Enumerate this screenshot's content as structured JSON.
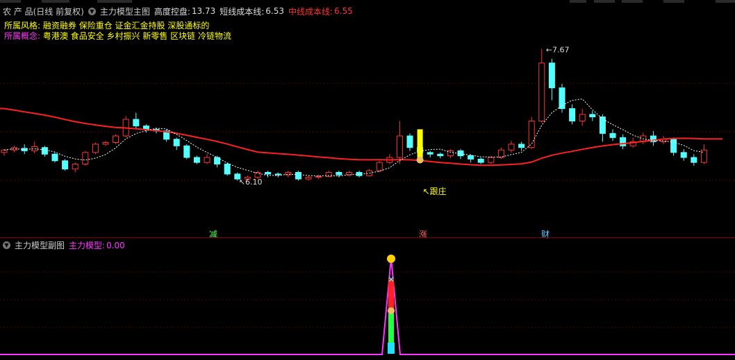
{
  "header": {
    "stock_title": "农 产 品(日线 前复权)",
    "indicator_name": "主力模型主图",
    "height_label": "高度控盘:",
    "height_value": "13.73",
    "short_label": "短线成本线:",
    "short_value": "6.53",
    "mid_label": "中线成本线:",
    "mid_value": "6.55"
  },
  "info": {
    "style_label": "所属风格:",
    "style_value": "融资融券 保险重仓 证金汇金持股 深股通标的",
    "concept_label": "所属概念:",
    "concept_value": "粤港澳 食品安全 乡村振兴 新零售 区块链 冷链物流"
  },
  "annotations": {
    "high_label": "7.67",
    "low_label": "6.10",
    "follow_label": "跟庄"
  },
  "markers": {
    "jian": "减",
    "zhang": "涨",
    "cai": "财"
  },
  "sub": {
    "title": "主力模型副图",
    "model_label": "主力模型:",
    "model_value": "0.00"
  },
  "colors": {
    "up": "#ff3333",
    "down": "#54ffff",
    "ma_line": "#ff2020",
    "short_line": "#ffffff",
    "accent_yellow": "#ffff00",
    "magenta": "#ff33ff",
    "background": "#000000"
  },
  "chart_data": {
    "type": "candlestick",
    "count": 70,
    "price_range": [
      6.0,
      7.8
    ],
    "candles": [
      [
        6.42,
        6.45,
        6.38,
        6.46
      ],
      [
        6.45,
        6.48,
        6.42,
        6.5
      ],
      [
        6.47,
        6.44,
        6.4,
        6.52
      ],
      [
        6.44,
        6.49,
        6.41,
        6.55
      ],
      [
        6.48,
        6.4,
        6.37,
        6.5
      ],
      [
        6.4,
        6.32,
        6.3,
        6.42
      ],
      [
        6.32,
        6.22,
        6.2,
        6.34
      ],
      [
        6.22,
        6.28,
        6.18,
        6.3
      ],
      [
        6.28,
        6.42,
        6.26,
        6.44
      ],
      [
        6.42,
        6.52,
        6.4,
        6.54
      ],
      [
        6.52,
        6.54,
        6.5,
        6.56
      ],
      [
        6.54,
        6.62,
        6.52,
        6.64
      ],
      [
        6.62,
        6.82,
        6.6,
        6.86
      ],
      [
        6.82,
        6.74,
        6.7,
        6.9
      ],
      [
        6.74,
        6.7,
        6.66,
        6.76
      ],
      [
        6.7,
        6.68,
        6.65,
        6.72
      ],
      [
        6.68,
        6.58,
        6.55,
        6.7
      ],
      [
        6.58,
        6.5,
        6.45,
        6.6
      ],
      [
        6.5,
        6.36,
        6.34,
        6.52
      ],
      [
        6.36,
        6.3,
        6.28,
        6.38
      ],
      [
        6.3,
        6.36,
        6.28,
        6.4
      ],
      [
        6.36,
        6.28,
        6.24,
        6.38
      ],
      [
        6.28,
        6.16,
        6.14,
        6.3
      ],
      [
        6.16,
        6.1,
        6.08,
        6.18
      ],
      [
        6.1,
        6.12,
        6.08,
        6.14
      ],
      [
        6.12,
        6.18,
        6.1,
        6.2
      ],
      [
        6.18,
        6.16,
        6.12,
        6.2
      ],
      [
        6.16,
        6.15,
        6.12,
        6.18
      ],
      [
        6.15,
        6.18,
        6.12,
        6.2
      ],
      [
        6.18,
        6.1,
        6.08,
        6.2
      ],
      [
        6.1,
        6.12,
        6.08,
        6.14
      ],
      [
        6.12,
        6.13,
        6.1,
        6.15
      ],
      [
        6.13,
        6.18,
        6.12,
        6.2
      ],
      [
        6.18,
        6.15,
        6.12,
        6.2
      ],
      [
        6.15,
        6.18,
        6.13,
        6.2
      ],
      [
        6.18,
        6.14,
        6.12,
        6.2
      ],
      [
        6.14,
        6.2,
        6.13,
        6.22
      ],
      [
        6.2,
        6.3,
        6.18,
        6.32
      ],
      [
        6.3,
        6.36,
        6.28,
        6.4
      ],
      [
        6.36,
        6.62,
        6.28,
        6.8
      ],
      [
        6.62,
        6.48,
        6.44,
        6.65
      ],
      [
        6.48,
        6.42,
        6.4,
        6.5
      ],
      [
        6.42,
        6.4,
        6.36,
        6.44
      ],
      [
        6.4,
        6.38,
        6.35,
        6.42
      ],
      [
        6.38,
        6.44,
        6.35,
        6.46
      ],
      [
        6.44,
        6.38,
        6.34,
        6.46
      ],
      [
        6.38,
        6.34,
        6.3,
        6.4
      ],
      [
        6.34,
        6.3,
        6.28,
        6.36
      ],
      [
        6.3,
        6.36,
        6.28,
        6.38
      ],
      [
        6.36,
        6.45,
        6.34,
        6.48
      ],
      [
        6.45,
        6.52,
        6.42,
        6.56
      ],
      [
        6.52,
        6.48,
        6.44,
        6.55
      ],
      [
        6.48,
        6.8,
        6.46,
        6.85
      ],
      [
        6.8,
        7.5,
        6.78,
        7.67
      ],
      [
        7.5,
        7.2,
        7.05,
        7.55
      ],
      [
        7.2,
        6.95,
        6.9,
        7.25
      ],
      [
        6.95,
        6.8,
        6.76,
        7.0
      ],
      [
        6.8,
        6.88,
        6.74,
        6.95
      ],
      [
        6.88,
        6.85,
        6.8,
        6.92
      ],
      [
        6.85,
        6.65,
        6.55,
        6.88
      ],
      [
        6.65,
        6.6,
        6.56,
        6.7
      ],
      [
        6.6,
        6.5,
        6.46,
        6.64
      ],
      [
        6.5,
        6.55,
        6.48,
        6.6
      ],
      [
        6.55,
        6.62,
        6.52,
        6.66
      ],
      [
        6.62,
        6.55,
        6.5,
        6.68
      ],
      [
        6.55,
        6.58,
        6.52,
        6.62
      ],
      [
        6.58,
        6.42,
        6.38,
        6.6
      ],
      [
        6.42,
        6.36,
        6.32,
        6.46
      ],
      [
        6.36,
        6.3,
        6.26,
        6.4
      ],
      [
        6.3,
        6.45,
        6.28,
        6.52
      ]
    ]
  }
}
